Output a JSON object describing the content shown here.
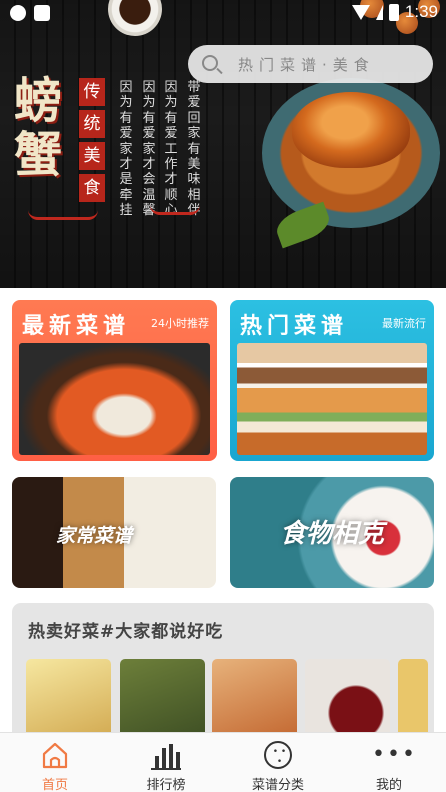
{
  "status_bar": {
    "time": "1:39"
  },
  "banner": {
    "title": "螃蟹",
    "seals": [
      "传",
      "统",
      "美",
      "食"
    ],
    "columns": [
      "因为有爱家才是牵挂",
      "因为有爱家才会温馨",
      "因为有爱工作才顺心",
      "带爱回家有美味相伴"
    ]
  },
  "search": {
    "placeholder": "热门菜谱·美食"
  },
  "cards": {
    "newest": {
      "title": "最新菜谱",
      "subtitle": "24小时推荐"
    },
    "hot": {
      "title": "热门菜谱",
      "subtitle": "最新流行"
    },
    "home_style": {
      "title": "家常菜谱"
    },
    "food_conflict": {
      "title": "食物相克"
    }
  },
  "hot_sale": {
    "title": "热卖好菜#大家都说好吃"
  },
  "nav": {
    "home": "首页",
    "rank": "排行榜",
    "category": "菜谱分类",
    "me": "我的"
  },
  "colors": {
    "accent": "#f07a44",
    "newest_card": "#ff6a4a",
    "hot_card": "#23b4dc"
  }
}
